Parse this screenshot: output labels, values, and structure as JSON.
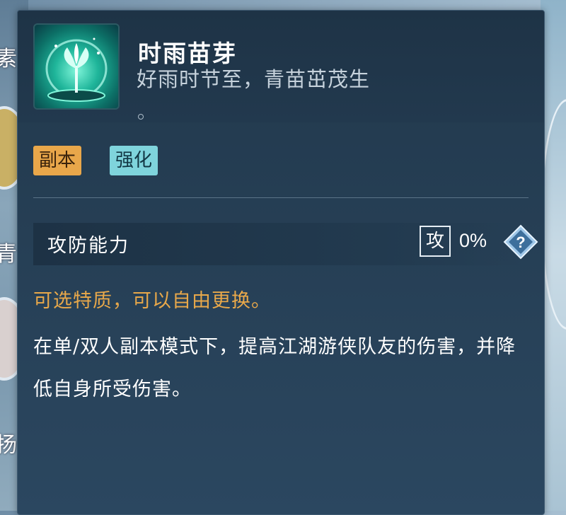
{
  "background": {
    "left_chars": [
      "素",
      "青",
      "扬"
    ]
  },
  "item": {
    "icon": "glowing-sprout-icon",
    "title": "时雨苗芽",
    "subtitle": "好雨时节至，青苗茁茂生",
    "subtitle_tail": "。"
  },
  "tags": [
    {
      "label": "副本",
      "color": "#e9a74a"
    },
    {
      "label": "强化",
      "color": "#7fd4dc"
    }
  ],
  "stat": {
    "label": "攻防能力",
    "badge": "攻",
    "value": "0%",
    "help_icon": "question-diamond-icon"
  },
  "description": {
    "highlight": "可选特质，可以自由更换。",
    "body": "在单/双人副本模式下，提高江湖游侠队友的伤害，并降低自身所受伤害。"
  },
  "colors": {
    "panel_bg": "#263f55",
    "highlight_text": "#e8a84a"
  }
}
